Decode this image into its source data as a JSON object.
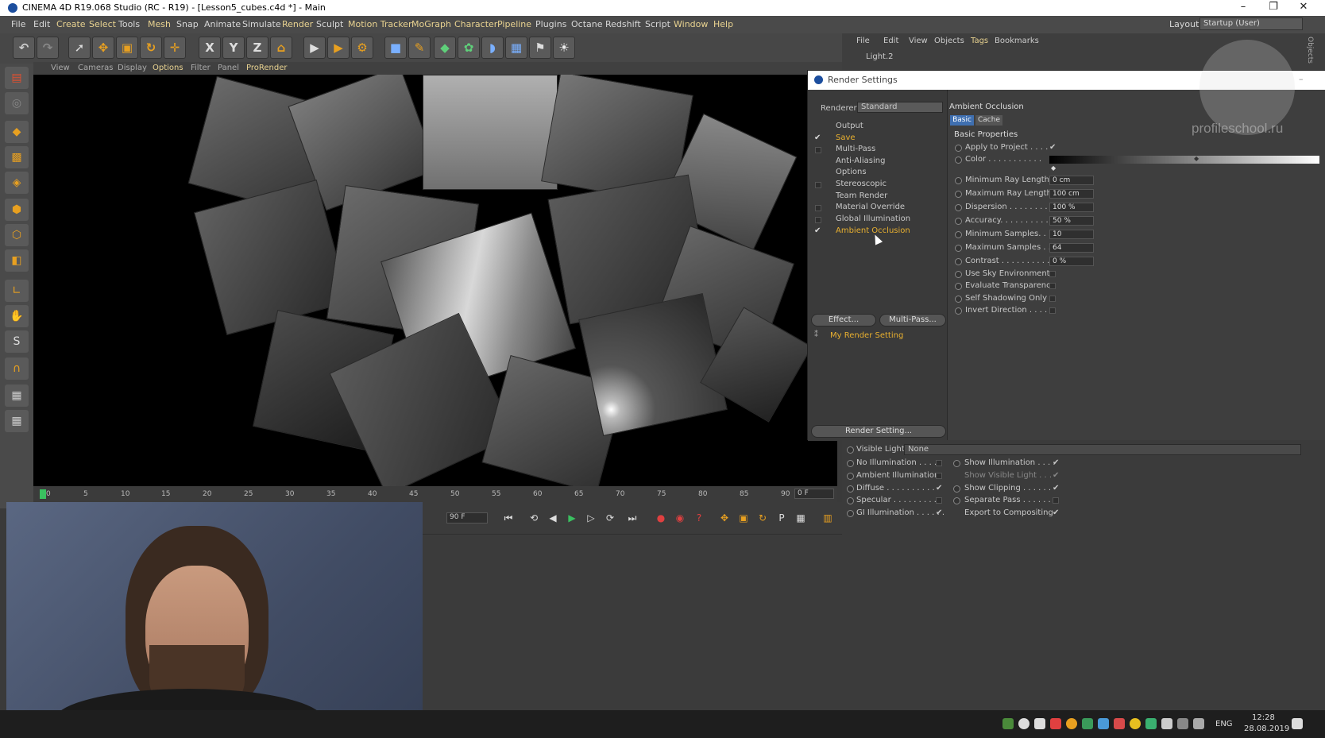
{
  "window": {
    "title": "CINEMA 4D R19.068 Studio (RC - R19) - [Lesson5_cubes.c4d *] - Main",
    "controls": [
      "–",
      "❐",
      "✕"
    ]
  },
  "menu": [
    "File",
    "Edit",
    "Create",
    "Select",
    "Tools",
    "Mesh",
    "Snap",
    "Animate",
    "Simulate",
    "Render",
    "Sculpt",
    "Motion Tracker",
    "MoGraph",
    "Character",
    "Pipeline",
    "Plugins",
    "Octane",
    "Redshift",
    "Script",
    "Window",
    "Help"
  ],
  "layout": {
    "label": "Layout:",
    "value": "Startup (User)"
  },
  "viewport_menu": [
    "View",
    "Cameras",
    "Display",
    "Options",
    "Filter",
    "Panel",
    "ProRender"
  ],
  "object_manager": {
    "menu": [
      "File",
      "Edit",
      "View",
      "Objects",
      "Tags",
      "Bookmarks"
    ],
    "item": "Light.2",
    "side_tab": "Objects"
  },
  "timeline": {
    "ticks": [
      "0",
      "5",
      "10",
      "15",
      "20",
      "25",
      "30",
      "35",
      "40",
      "45",
      "50",
      "55",
      "60",
      "65",
      "70",
      "75",
      "80",
      "85",
      "90"
    ],
    "frame_field": "0 F",
    "end_field": "90 F"
  },
  "render_settings": {
    "title": "Render Settings",
    "renderer_label": "Renderer",
    "renderer_value": "Standard",
    "list": [
      {
        "label": "Output",
        "check": ""
      },
      {
        "label": "Save",
        "check": "✔"
      },
      {
        "label": "Multi-Pass",
        "check": "box"
      },
      {
        "label": "Anti-Aliasing",
        "check": ""
      },
      {
        "label": "Options",
        "check": ""
      },
      {
        "label": "Stereoscopic",
        "check": "box"
      },
      {
        "label": "Team Render",
        "check": ""
      },
      {
        "label": "Material Override",
        "check": "box"
      },
      {
        "label": "Global Illumination",
        "check": "box"
      },
      {
        "label": "Ambient Occlusion",
        "check": "✔"
      }
    ],
    "effect_button": "Effect...",
    "multipass_button": "Multi-Pass...",
    "preset": "My Render Setting",
    "render_setting_button": "Render Setting...",
    "section_title": "Ambient Occlusion",
    "tabs": [
      "Basic",
      "Cache"
    ],
    "basic_properties": "Basic Properties",
    "props": [
      {
        "label": "Apply to Project . . . .",
        "value": "✔"
      },
      {
        "label": "Color . . . . . . . . . . .",
        "value": ""
      },
      {
        "label": "Minimum Ray Length",
        "value": "0 cm"
      },
      {
        "label": "Maximum Ray Length",
        "value": "100 cm"
      },
      {
        "label": "Dispersion . . . . . . . .",
        "value": "100 %"
      },
      {
        "label": "Accuracy. . . . . . . . . .",
        "value": "50 %"
      },
      {
        "label": "Minimum Samples. . . .",
        "value": "10"
      },
      {
        "label": "Maximum Samples . . .",
        "value": "64"
      },
      {
        "label": "Contrast . . . . . . . . . .",
        "value": "0 %"
      },
      {
        "label": "Use Sky Environment",
        "value": ""
      },
      {
        "label": "Evaluate Transparency",
        "value": ""
      },
      {
        "label": "Self Shadowing Only",
        "value": ""
      },
      {
        "label": "Invert Direction . . . .",
        "value": ""
      }
    ]
  },
  "attributes": {
    "visible_light_label": "Visible Light",
    "visible_light_value": "None",
    "left": [
      {
        "label": "No Illumination . . . . .",
        "check": ""
      },
      {
        "label": "Ambient Illumination",
        "check": ""
      },
      {
        "label": "Diffuse . . . . . . . . . .",
        "check": "✔"
      },
      {
        "label": "Specular . . . . . . . . . .",
        "check": ""
      },
      {
        "label": "GI Illumination . . . . . .",
        "check": "✔"
      }
    ],
    "right": [
      {
        "label": "Show Illumination . . . .",
        "check": "✔"
      },
      {
        "label": "Show Visible Light . . .",
        "check": "✔"
      },
      {
        "label": "Show Clipping . . . . . .",
        "check": "✔"
      },
      {
        "label": "Separate Pass . . . . . .",
        "check": ""
      },
      {
        "label": "Export to Compositing",
        "check": "✔"
      }
    ]
  },
  "watermark": "profileschool.ru",
  "taskbar": {
    "lang": "ENG",
    "time": "12:28",
    "date": "28.08.2019"
  }
}
